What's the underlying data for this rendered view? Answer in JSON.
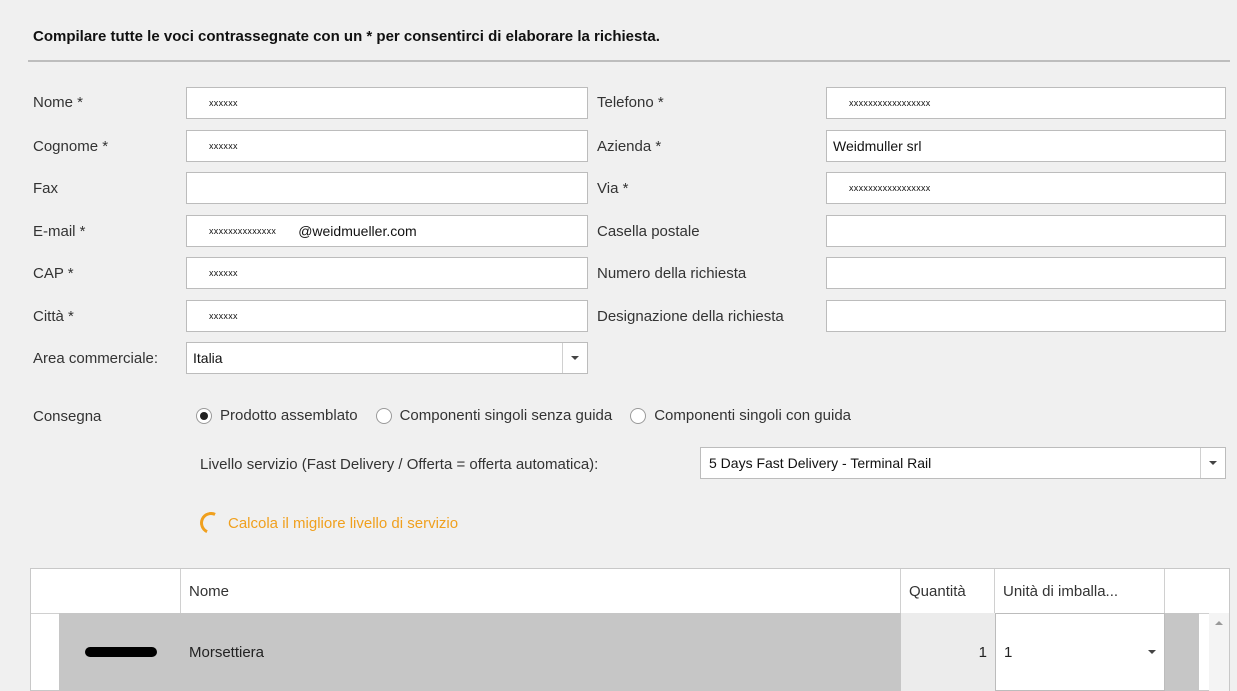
{
  "form": {
    "heading": "Compilare tutte le voci contrassegnate con un * per consentirci di elaborare la richiesta.",
    "left_fields": [
      {
        "label": "Nome *",
        "value": "xxxxxx"
      },
      {
        "label": "Cognome *",
        "value": "xxxxxx"
      },
      {
        "label": "Fax",
        "value": ""
      },
      {
        "label": "E-mail *",
        "value": "xxxxxxxxxxxxxx",
        "suffix": "@weidmueller.com"
      },
      {
        "label": "CAP *",
        "value": "xxxxxx"
      },
      {
        "label": "Città *",
        "value": "xxxxxx"
      }
    ],
    "right_fields": [
      {
        "label": "Telefono *",
        "value": "xxxxxxxxxxxxxxxxx"
      },
      {
        "label": "Azienda *",
        "value": "Weidmuller srl"
      },
      {
        "label": "Via *",
        "value": "xxxxxxxxxxxxxxxxx"
      },
      {
        "label": "Casella postale",
        "value": ""
      },
      {
        "label": "Numero della richiesta",
        "value": ""
      },
      {
        "label": "Designazione della richiesta",
        "value": ""
      }
    ],
    "area": {
      "label": "Area commerciale:",
      "value": "Italia"
    }
  },
  "delivery": {
    "label": "Consegna",
    "options": [
      "Prodotto assemblato",
      "Componenti singoli senza guida",
      "Componenti singoli con guida"
    ],
    "selected_index": 0,
    "service_label": "Livello servizio (Fast Delivery / Offerta = offerta automatica):",
    "service_value": "5 Days Fast Delivery  - Terminal Rail",
    "calc_link": "Calcola il migliore livello di servizio",
    "calc_color": "#f0a01e"
  },
  "table": {
    "headers": [
      "Nome",
      "Quantità",
      "Unità di imballa..."
    ],
    "rows": [
      {
        "name": "Morsettiera",
        "quantity": "1",
        "unit": "1"
      }
    ]
  }
}
